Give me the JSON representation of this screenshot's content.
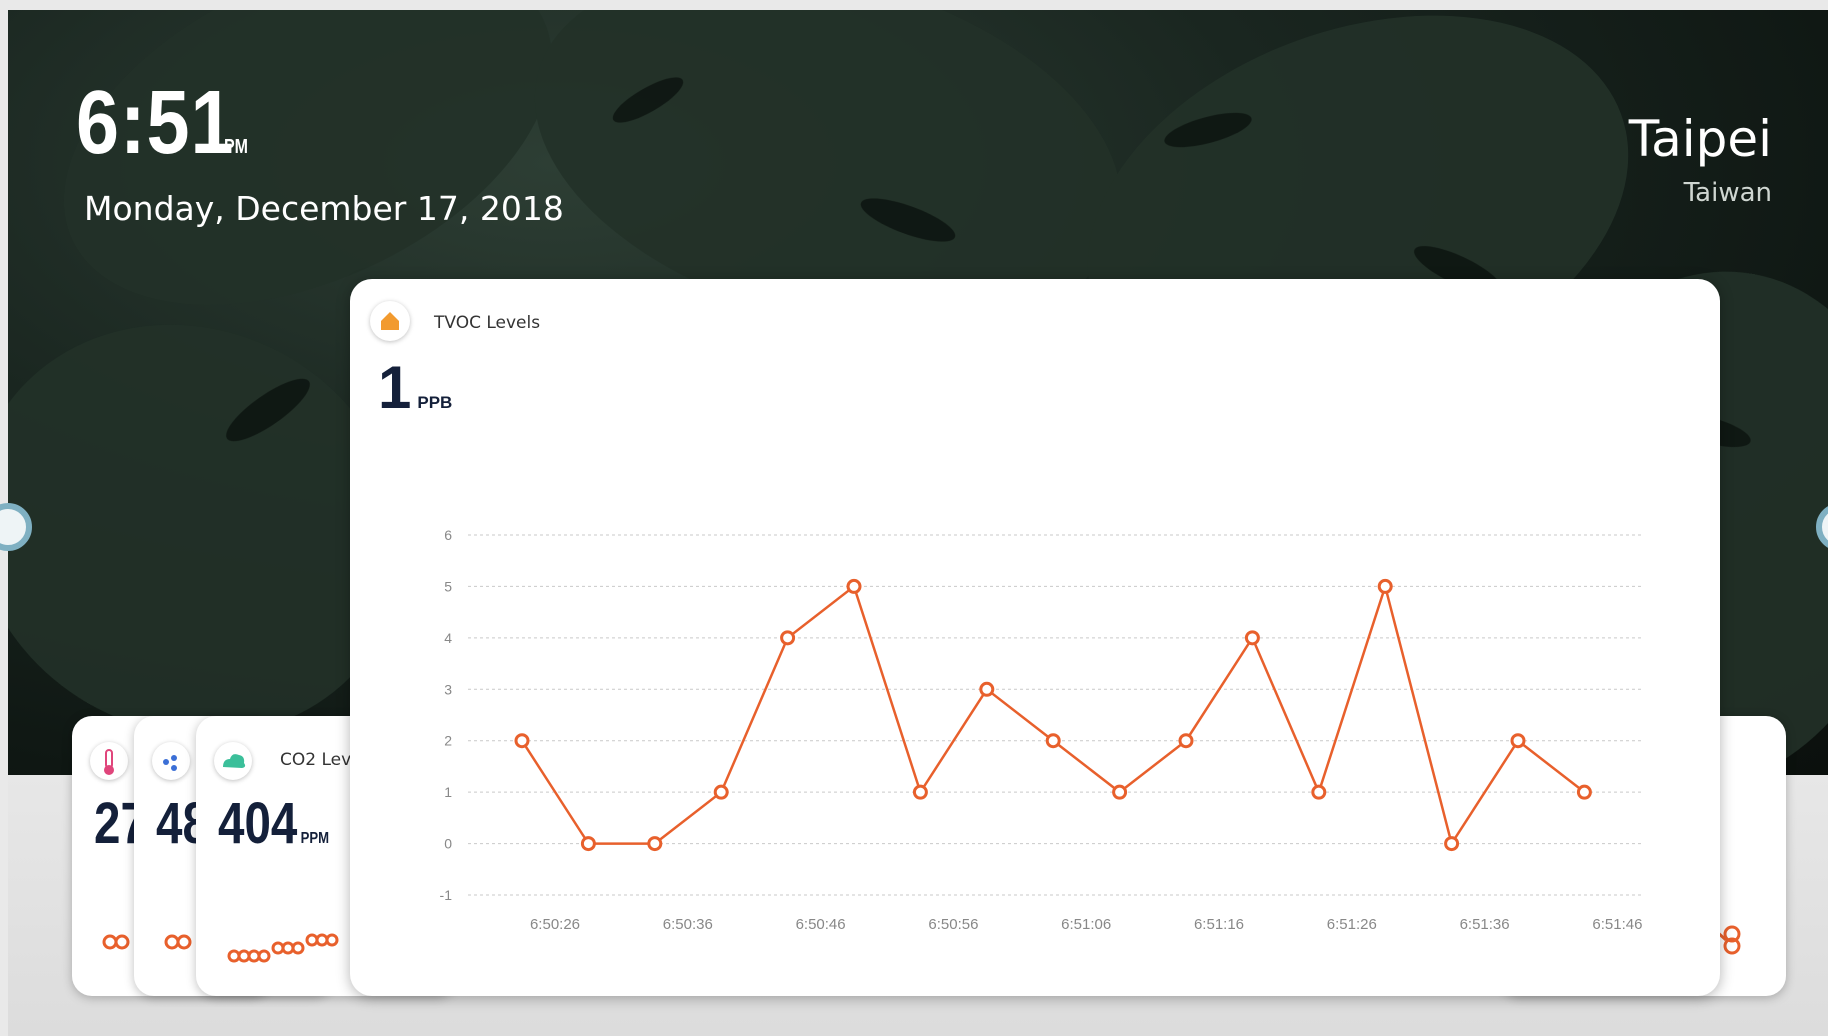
{
  "clock": {
    "time": "6:51",
    "ampm": "PM",
    "date": "Monday, December 17, 2018"
  },
  "location": {
    "city": "Taipei",
    "country": "Taiwan"
  },
  "mini_cards": [
    {
      "value": "27",
      "icon": "thermometer-icon",
      "accent": "#e0457b"
    },
    {
      "value": "48",
      "icon": "humidity-icon",
      "accent": "#3b6fd6"
    },
    {
      "value": "404",
      "unit": "PPM",
      "label": "CO2 Lev",
      "icon": "co2-cloud-icon",
      "accent": "#3bbf9a"
    }
  ],
  "main_card": {
    "title": "TVOC Levels",
    "value": "1",
    "unit": "PPB",
    "icon": "home-icon",
    "accent": "#f29a2e"
  },
  "chart_data": {
    "type": "line",
    "title": "TVOC Levels",
    "xlabel": "",
    "ylabel": "",
    "ylim": [
      -1,
      6
    ],
    "yticks": [
      "6",
      "5",
      "4",
      "3",
      "2",
      "1",
      "0",
      "-1"
    ],
    "xtick_labels": [
      "6:50:26",
      "6:50:36",
      "6:50:46",
      "6:50:56",
      "6:51:06",
      "6:51:16",
      "6:51:26",
      "6:51:36",
      "6:51:46"
    ],
    "series": [
      {
        "color": "#e8602c",
        "values": [
          2,
          0,
          0,
          1,
          4,
          5,
          1,
          3,
          2,
          1,
          2,
          4,
          1,
          5,
          0,
          2,
          1
        ]
      }
    ],
    "grid": true
  }
}
